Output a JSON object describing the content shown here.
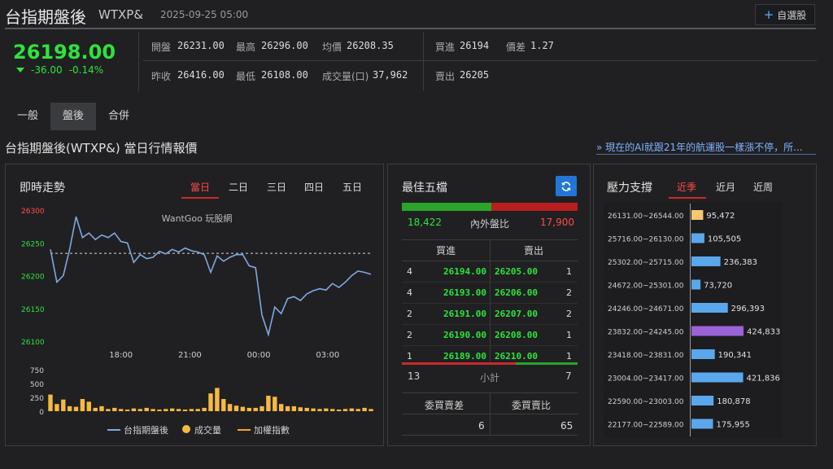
{
  "header": {
    "title": "台指期盤後",
    "code": "WTXP&",
    "datetime": "2025-09-25 05:00",
    "watch_label": "自選股"
  },
  "quote": {
    "price": "26198.00",
    "change": "-36.00",
    "change_pct": "-0.14%",
    "fields": {
      "open_label": "開盤",
      "open": "26231.00",
      "high_label": "最高",
      "high": "26296.00",
      "avg_label": "均價",
      "avg": "26208.35",
      "prev_label": "昨收",
      "prev": "26416.00",
      "low_label": "最低",
      "low": "26108.00",
      "vol_label": "成交量(口)",
      "vol": "37,962",
      "bid_label": "買進",
      "bid": "26194",
      "spread_label": "價差",
      "spread": "1.27",
      "ask_label": "賣出",
      "ask": "26205"
    }
  },
  "tabs": [
    "一般",
    "盤後",
    "合併"
  ],
  "section_title": "台指期盤後(WTXP&) 當日行情報價",
  "news_link": "» 現在的AI就跟21年的航運股一樣漲不停，所...",
  "chart_panel": {
    "title": "即時走勢",
    "range_tabs": [
      "當日",
      "二日",
      "三日",
      "四日",
      "五日"
    ],
    "watermark": "WantGoo 玩股網",
    "legend": [
      "台指期盤後",
      "成交量",
      "加權指數"
    ]
  },
  "chart_data": {
    "type": "line",
    "title": "",
    "ylim": [
      26100,
      26300
    ],
    "y_ticks": [
      "26300",
      "26250",
      "26200",
      "26150",
      "26100"
    ],
    "x_ticks": [
      "18:00",
      "21:00",
      "00:00",
      "03:00"
    ],
    "reference_line": 26234,
    "series": [
      {
        "name": "台指期盤後",
        "x": [
          0,
          2,
          4,
          6,
          8,
          10,
          12,
          14,
          16,
          18,
          20,
          22,
          24,
          26,
          28,
          30,
          32,
          34,
          36,
          38,
          40,
          42,
          44,
          46,
          48,
          50,
          52,
          54,
          56,
          58,
          60,
          62,
          64,
          66,
          68,
          70,
          72,
          74,
          76,
          78,
          80,
          82,
          84,
          86,
          88,
          90,
          92,
          94,
          96,
          98,
          100
        ],
        "values": [
          26240,
          26190,
          26200,
          26240,
          26290,
          26258,
          26265,
          26255,
          26262,
          26258,
          26265,
          26252,
          26250,
          26220,
          26232,
          26226,
          26228,
          26237,
          26233,
          26240,
          26236,
          26242,
          26238,
          26236,
          26232,
          26205,
          26230,
          26222,
          26228,
          26232,
          26232,
          26215,
          26212,
          26140,
          26110,
          26152,
          26142,
          26165,
          26168,
          26162,
          26172,
          26177,
          26180,
          26178,
          26188,
          26182,
          26190,
          26200,
          26207,
          26205,
          26202
        ]
      }
    ],
    "volume": {
      "name": "成交量",
      "ylim": [
        0,
        750
      ],
      "y_ticks": [
        "750",
        "500",
        "250",
        "0"
      ],
      "x": [
        0,
        2,
        4,
        6,
        8,
        10,
        12,
        14,
        16,
        18,
        20,
        22,
        24,
        26,
        28,
        30,
        32,
        34,
        36,
        38,
        40,
        42,
        44,
        46,
        48,
        50,
        52,
        54,
        56,
        58,
        60,
        62,
        64,
        66,
        68,
        70,
        72,
        74,
        76,
        78,
        80,
        82,
        84,
        86,
        88,
        90,
        92,
        94,
        96,
        98,
        100
      ],
      "values": [
        300,
        130,
        210,
        90,
        80,
        220,
        170,
        60,
        90,
        40,
        60,
        40,
        30,
        50,
        40,
        60,
        40,
        30,
        40,
        50,
        40,
        30,
        40,
        40,
        60,
        320,
        420,
        220,
        130,
        100,
        80,
        60,
        60,
        90,
        280,
        260,
        130,
        90,
        90,
        70,
        60,
        50,
        40,
        50,
        40,
        30,
        40,
        50,
        40,
        60,
        40
      ]
    }
  },
  "order_book": {
    "title": "最佳五檔",
    "inner_label": "內外盤比",
    "inner_buy": "18,422",
    "inner_sell": "17,900",
    "inner_buy_ratio": 0.507,
    "col_bid": "買進",
    "col_ask": "賣出",
    "rows": [
      {
        "bid_qty": "4",
        "bid_price": "26194.00",
        "ask_price": "26205.00",
        "ask_qty": "1"
      },
      {
        "bid_qty": "4",
        "bid_price": "26193.00",
        "ask_price": "26206.00",
        "ask_qty": "2"
      },
      {
        "bid_qty": "2",
        "bid_price": "26191.00",
        "ask_price": "26207.00",
        "ask_qty": "2"
      },
      {
        "bid_qty": "2",
        "bid_price": "26190.00",
        "ask_price": "26208.00",
        "ask_qty": "1"
      },
      {
        "bid_qty": "1",
        "bid_price": "26189.00",
        "ask_price": "26210.00",
        "ask_qty": "1"
      }
    ],
    "subtotal_label": "小計",
    "subtotal_bid": "13",
    "subtotal_ask": "7",
    "subtotal_bid_ratio": 0.65,
    "diff_label": "委買賣差",
    "ratio_label": "委買賣比",
    "diff_value": "6",
    "ratio_value": "65"
  },
  "pressure": {
    "title": "壓力支撐",
    "tabs": [
      "近季",
      "近月",
      "近周"
    ],
    "max": 424833,
    "rows": [
      {
        "range": "26131.00~26544.00",
        "value": "95,472",
        "num": 95472,
        "color": "#f5c870"
      },
      {
        "range": "25716.00~26130.00",
        "value": "105,505",
        "num": 105505,
        "color": "#5aa7ec"
      },
      {
        "range": "25302.00~25715.00",
        "value": "236,383",
        "num": 236383,
        "color": "#5aa7ec"
      },
      {
        "range": "24672.00~25301.00",
        "value": "73,720",
        "num": 73720,
        "color": "#5aa7ec"
      },
      {
        "range": "24246.00~24671.00",
        "value": "296,393",
        "num": 296393,
        "color": "#5aa7ec"
      },
      {
        "range": "23832.00~24245.00",
        "value": "424,833",
        "num": 424833,
        "color": "#9a63d8"
      },
      {
        "range": "23418.00~23831.00",
        "value": "190,341",
        "num": 190341,
        "color": "#5aa7ec"
      },
      {
        "range": "23004.00~23417.00",
        "value": "421,836",
        "num": 421836,
        "color": "#5aa7ec"
      },
      {
        "range": "22590.00~23003.00",
        "value": "180,878",
        "num": 180878,
        "color": "#5aa7ec"
      },
      {
        "range": "22177.00~22589.00",
        "value": "175,955",
        "num": 175955,
        "color": "#5aa7ec"
      }
    ]
  }
}
